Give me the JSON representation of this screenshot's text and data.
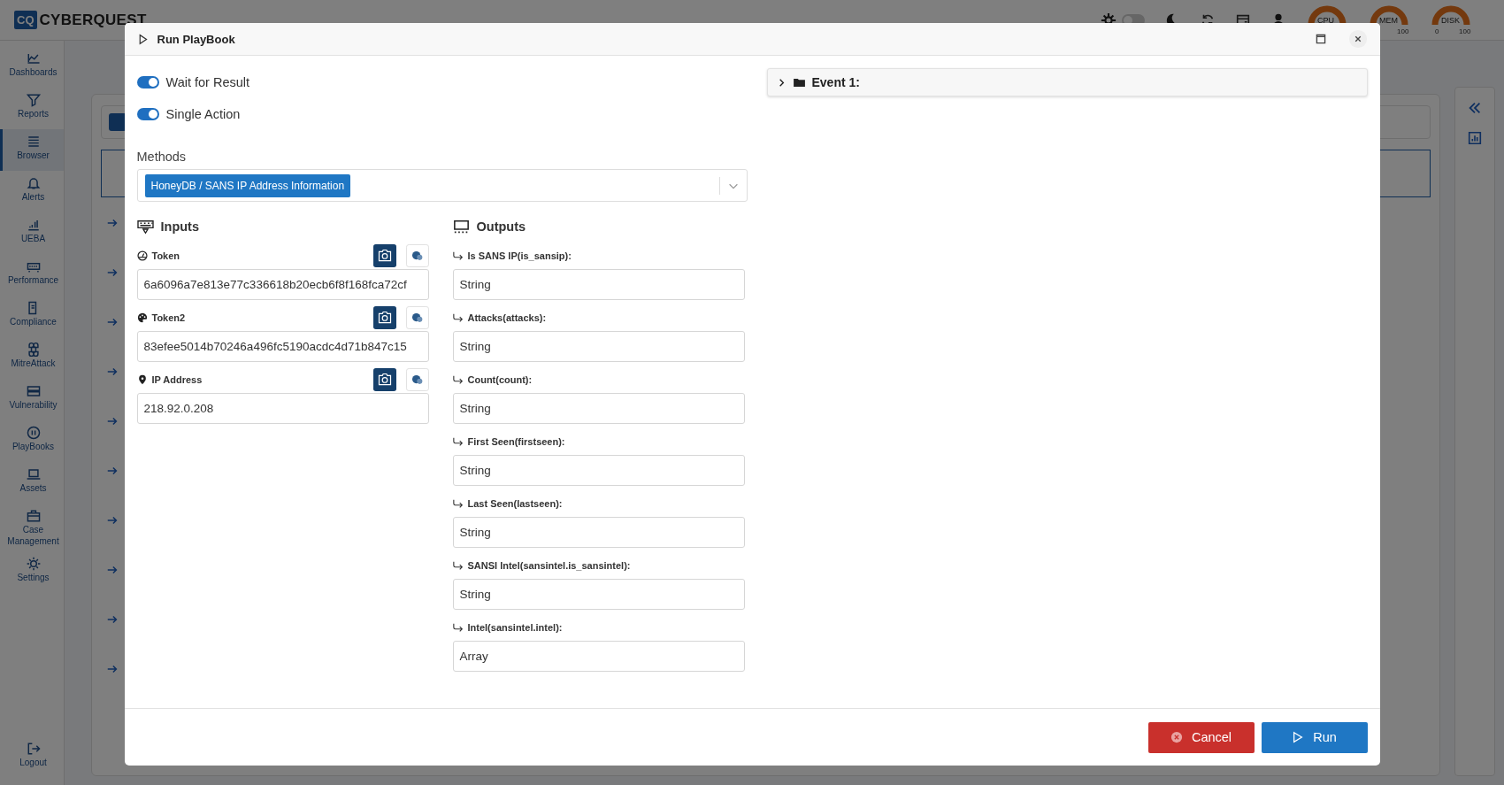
{
  "app": {
    "logo_mark": "CQ",
    "logo_text": "CYBERQUEST",
    "theme_toggle": {
      "on": false
    },
    "gauges": [
      {
        "label": "CPU"
      },
      {
        "label": "MEM",
        "max": "100"
      },
      {
        "label": "DISK",
        "min": "0",
        "max": "100"
      }
    ]
  },
  "sidebar": {
    "items": [
      {
        "label": "Dashboards",
        "selected": false
      },
      {
        "label": "Reports",
        "selected": false
      },
      {
        "label": "Browser",
        "selected": true
      },
      {
        "label": "Alerts",
        "selected": false
      },
      {
        "label": "UEBA",
        "selected": false
      },
      {
        "label": "Performance",
        "selected": false
      },
      {
        "label": "Compliance",
        "selected": false
      },
      {
        "label": "MitreAttack",
        "selected": false
      },
      {
        "label": "Vulnerability",
        "selected": false
      },
      {
        "label": "PlayBooks",
        "selected": false
      },
      {
        "label": "Assets",
        "selected": false
      },
      {
        "label": "Case Management",
        "selected": false
      },
      {
        "label": "Settings",
        "selected": false
      }
    ],
    "logout": "Logout"
  },
  "dialog": {
    "title": "Run PlayBook",
    "toggles": [
      {
        "label": "Wait for Result",
        "on": true
      },
      {
        "label": "Single Action",
        "on": true
      }
    ],
    "methods": {
      "label": "Methods",
      "tags": [
        "HoneyDB / SANS IP Address Information"
      ]
    },
    "inputs": {
      "title": "Inputs",
      "fields": [
        {
          "kind": "token",
          "label": "Token",
          "value": "6a6096a7e813e77c336618b20ecb6f8f168fca72cf"
        },
        {
          "kind": "token2",
          "label": "Token2",
          "value": "83efee5014b70246a496fc5190acdc4d71b847c15"
        },
        {
          "kind": "location",
          "label": "IP Address",
          "value": "218.92.0.208"
        }
      ]
    },
    "outputs": {
      "title": "Outputs",
      "fields": [
        {
          "label": "Is SANS IP(is_sansip):",
          "value": "String"
        },
        {
          "label": "Attacks(attacks):",
          "value": "String"
        },
        {
          "label": "Count(count):",
          "value": "String"
        },
        {
          "label": "First Seen(firstseen):",
          "value": "String"
        },
        {
          "label": "Last Seen(lastseen):",
          "value": "String"
        },
        {
          "label": "SANSI Intel(sansintel.is_sansintel):",
          "value": "String"
        },
        {
          "label": "Intel(sansintel.intel):",
          "value": "Array"
        }
      ]
    },
    "events": [
      {
        "label": "Event 1:",
        "expanded": false
      }
    ],
    "buttons": [
      {
        "kind": "cancel",
        "label": "Cancel"
      },
      {
        "kind": "run",
        "label": "Run"
      }
    ]
  }
}
